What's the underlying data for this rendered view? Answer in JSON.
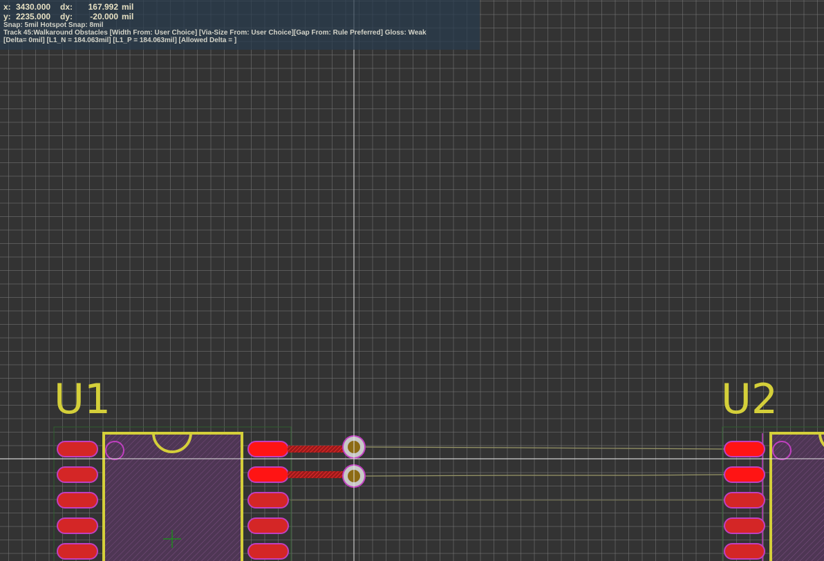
{
  "hud": {
    "x_label": "x:",
    "x_value": "3430.000",
    "dx_label": "dx:",
    "dx_value": "167.992",
    "dx_unit": "mil",
    "y_label": "y:",
    "y_value": "2235.000",
    "dy_label": "dy:",
    "dy_value": "-20.000",
    "dy_unit": "mil",
    "snap": "Snap: 5mil Hotspot Snap: 8mil",
    "track": "Track 45:Walkaround Obstacles [Width From: User Choice] [Via-Size From: User Choice][Gap From: Rule Preferred] Gloss: Weak",
    "delta": "[Delta= 0mil] [L1_N = 184.063mil] [L1_P = 184.063mil] [Allowed Delta = ]"
  },
  "components": {
    "u1_designator": "U1",
    "u2_designator": "U2"
  },
  "colors": {
    "background": "#333333",
    "grid": "#787878",
    "silkscreen": "#d4cf3a",
    "pad": "#f41a1a",
    "pad_outline": "#c040c0",
    "courtyard": "#c040c0",
    "via_ring": "#c8c8c8",
    "via_hole": "#8c6a14",
    "crosshair": "#e0e0e0"
  }
}
